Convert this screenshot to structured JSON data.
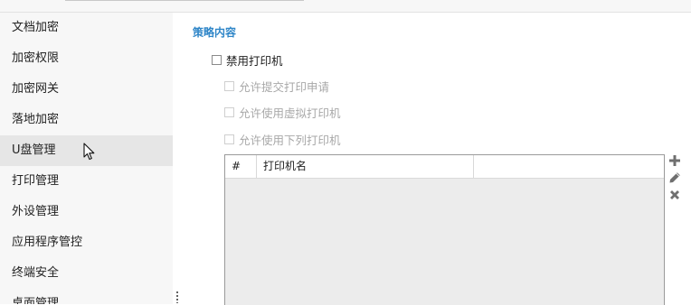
{
  "sidebar": {
    "items": [
      {
        "label": "文档加密"
      },
      {
        "label": "加密权限"
      },
      {
        "label": "加密网关"
      },
      {
        "label": "落地加密"
      },
      {
        "label": "U盘管理"
      },
      {
        "label": "打印管理"
      },
      {
        "label": "外设管理"
      },
      {
        "label": "应用程序管控"
      },
      {
        "label": "终端安全"
      },
      {
        "label": "桌面管理"
      }
    ],
    "active_index": 4
  },
  "main": {
    "section_title": "策略内容",
    "disable_printer": {
      "label": "禁用打印机",
      "checked": false
    },
    "options": [
      {
        "label": "允许提交打印申请",
        "checked": false,
        "disabled": true
      },
      {
        "label": "允许使用虚拟打印机",
        "checked": false,
        "disabled": true
      },
      {
        "label": "允许使用下列打印机",
        "checked": false,
        "disabled": true
      }
    ],
    "table": {
      "columns": [
        "#",
        "打印机名",
        ""
      ],
      "rows": []
    },
    "tools": [
      "add-icon",
      "edit-icon",
      "delete-icon"
    ]
  },
  "colors": {
    "accent": "#2f86c8",
    "sidebar_bg": "#f7f7f7",
    "active_bg": "#e6e6e6",
    "table_body_bg": "#ececec",
    "disabled_text": "#a8a8a8"
  }
}
